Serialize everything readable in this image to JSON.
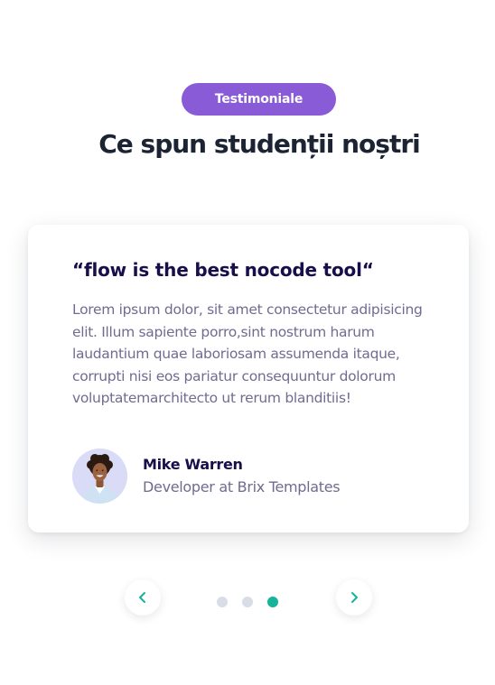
{
  "section": {
    "badge": "Testimoniale",
    "title": "Ce spun studenții noștri"
  },
  "testimonial": {
    "quote_title": "“flow is the best nocode tool“",
    "quote_body": "Lorem ipsum dolor, sit amet consectetur adipisicing elit. Illum sapiente porro,sint nostrum harum laudantium quae laboriosam assumenda itaque, corrupti nisi eos pariatur consequuntur dolorum voluptatemarchitecto ut rerum blanditiis!",
    "author_name": "Mike Warren",
    "author_role": "Developer at Brix Templates",
    "avatar": "avatar-portrait-icon"
  },
  "carousel": {
    "prev_icon": "chevron-left-icon",
    "next_icon": "chevron-right-icon",
    "slide_count": 3,
    "active_index": 2
  },
  "colors": {
    "badge_bg": "#8a5bd6",
    "heading": "#1c2333",
    "quote_title": "#170f49",
    "body_text": "#6f6c90",
    "accent": "#14b39a",
    "dot_inactive": "#d9dde5",
    "avatar_bg": "#d9dbf7"
  }
}
